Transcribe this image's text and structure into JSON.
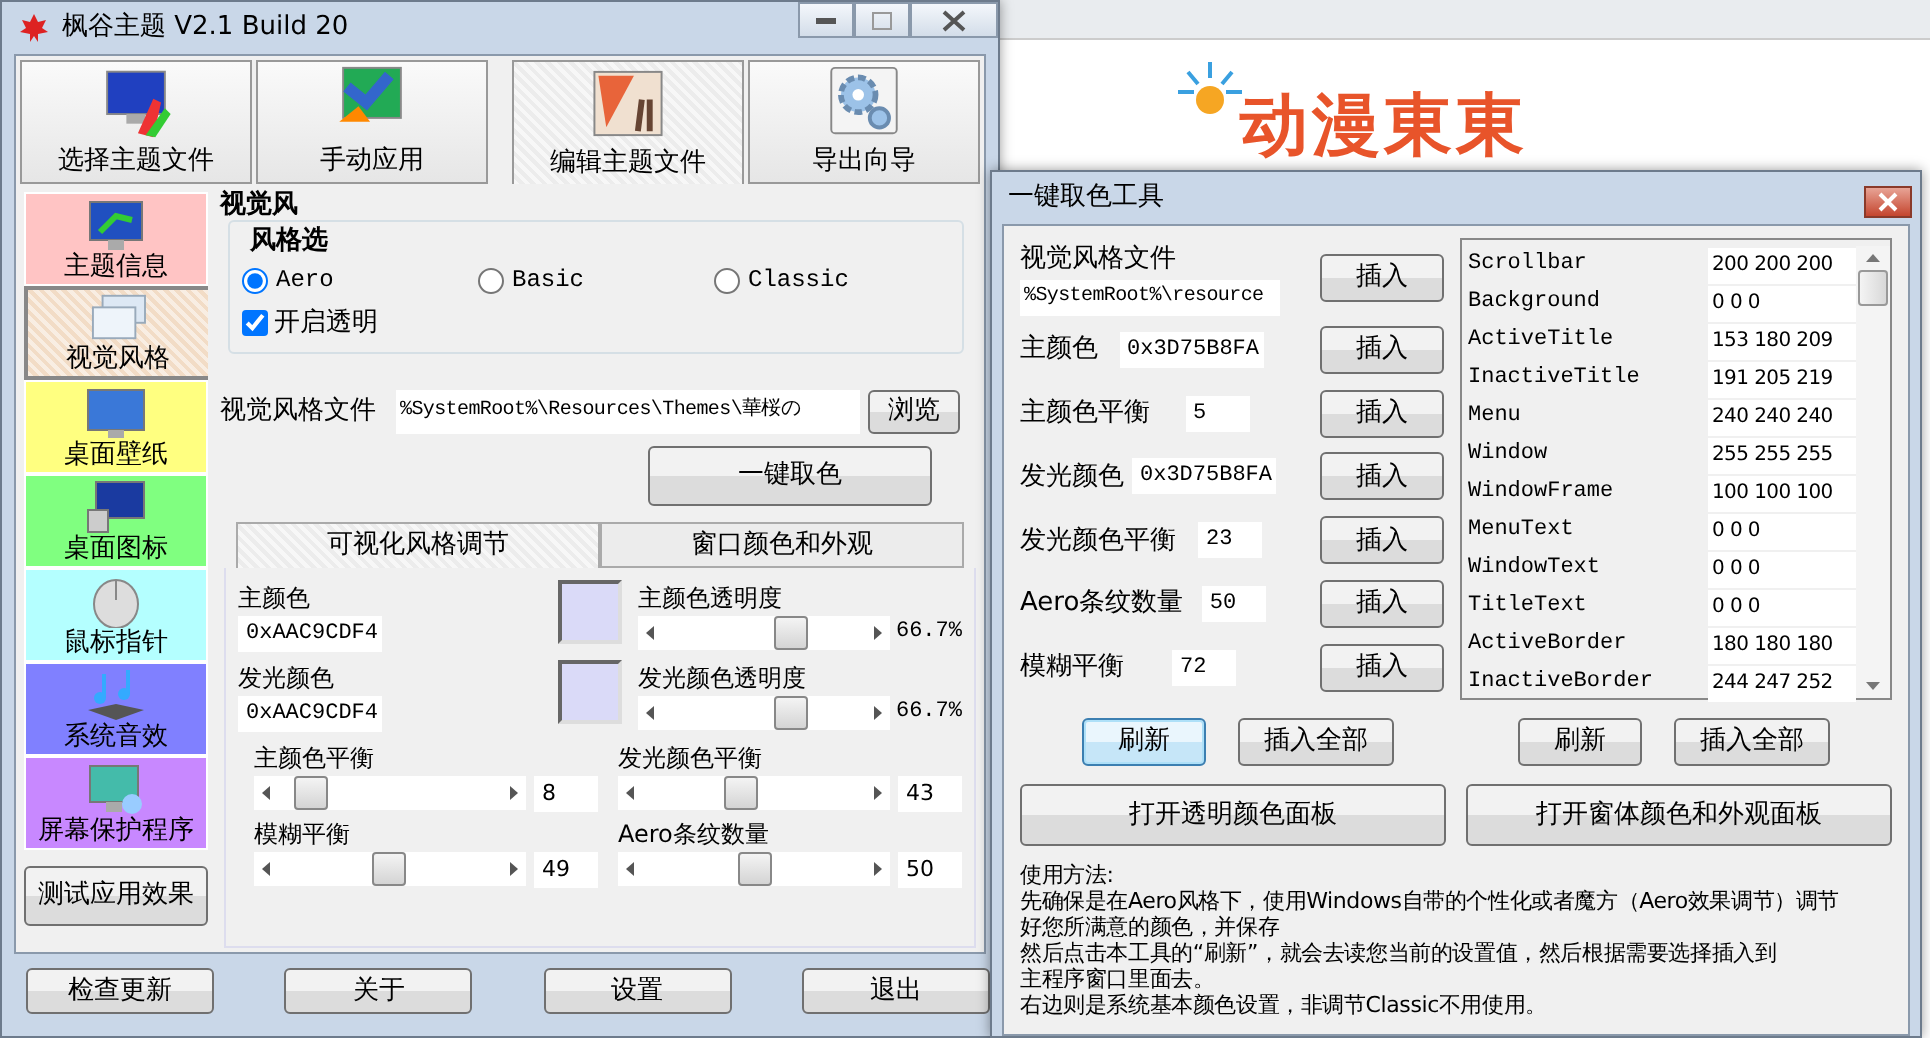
{
  "background": {
    "logo": "动漫東東"
  },
  "main_window": {
    "title": "枫谷主题 V2.1 Build 20",
    "toolbar": [
      {
        "label": "选择主题文件",
        "selected": false
      },
      {
        "label": "手动应用",
        "selected": false
      },
      {
        "label": "编辑主题文件",
        "selected": true
      },
      {
        "label": "导出向导",
        "selected": false
      }
    ],
    "sidebar": [
      {
        "label": "主题信息",
        "color": "#ffc4c4",
        "selected": false
      },
      {
        "label": "视觉风格",
        "color": "#f2dcc6",
        "selected": true
      },
      {
        "label": "桌面壁纸",
        "color": "#ffff80",
        "selected": false
      },
      {
        "label": "桌面图标",
        "color": "#80ff80",
        "selected": false
      },
      {
        "label": "鼠标指针",
        "color": "#b4ffff",
        "selected": false
      },
      {
        "label": "系统音效",
        "color": "#8080ff",
        "selected": false
      },
      {
        "label": "屏幕保护程序",
        "color": "#c888ff",
        "selected": false
      }
    ],
    "sidebar_button": "测试应用效果",
    "section_title": "视觉风",
    "style_group": {
      "title": "风格选",
      "options": [
        {
          "label": "Aero",
          "selected": true
        },
        {
          "label": "Basic",
          "selected": false
        },
        {
          "label": "Classic",
          "selected": false
        }
      ],
      "transparency": {
        "label": "开启透明",
        "checked": true
      }
    },
    "file_label": "视觉风格文件",
    "file_value": "%SystemRoot%\\Resources\\Themes\\華桜の",
    "browse_button": "浏览",
    "pick_button": "一键取色",
    "subtabs": [
      {
        "label": "可视化风格调节",
        "selected": true
      },
      {
        "label": "窗口颜色和外观",
        "selected": false
      }
    ],
    "colors": [
      {
        "label": "主颜色",
        "value": "0xAAC9CDF4",
        "color": "#dadaf8",
        "opacity_label": "主颜色透明度",
        "level": 0.66,
        "reading": "66.7%"
      },
      {
        "label": "发光颜色",
        "value": "0xAAC9CDF4",
        "color": "#dadaf8",
        "opacity_label": "发光颜色透明度",
        "level": 0.66,
        "reading": "66.7%"
      }
    ],
    "sliders": [
      {
        "label": "主颜色平衡",
        "level": 0.08,
        "value": "8"
      },
      {
        "label": "发光颜色平衡",
        "level": 0.43,
        "value": "43"
      },
      {
        "label": "模糊平衡",
        "level": 0.49,
        "value": "49"
      },
      {
        "label": "Aero条纹数量",
        "level": 0.5,
        "value": "50"
      }
    ],
    "footer_buttons": [
      "检查更新",
      "关于",
      "设置",
      "退出"
    ]
  },
  "picker_window": {
    "title": "一键取色工具",
    "fields": [
      {
        "label": "视觉风格文件",
        "value": "%SystemRoot%\\resource",
        "button": "插入",
        "kind": "wide"
      },
      {
        "label": "主颜色",
        "value": "0x3D75B8FA",
        "button": "插入",
        "kind": "medium"
      },
      {
        "label": "主颜色平衡",
        "value": "5",
        "button": "插入",
        "kind": "short"
      },
      {
        "label": "发光颜色",
        "value": "0x3D75B8FA",
        "button": "插入",
        "kind": "medium"
      },
      {
        "label": "发光颜色平衡",
        "value": "23",
        "button": "插入",
        "kind": "short"
      },
      {
        "label": "Aero条纹数量",
        "value": "50",
        "button": "插入",
        "kind": "short"
      },
      {
        "label": "模糊平衡",
        "value": "72",
        "button": "插入",
        "kind": "short"
      }
    ],
    "system_colors": [
      {
        "name": "Scrollbar",
        "value": "200 200 200"
      },
      {
        "name": "Background",
        "value": "0 0 0"
      },
      {
        "name": "ActiveTitle",
        "value": "153 180 209"
      },
      {
        "name": "InactiveTitle",
        "value": "191 205 219"
      },
      {
        "name": "Menu",
        "value": "240 240 240"
      },
      {
        "name": "Window",
        "value": "255 255 255"
      },
      {
        "name": "WindowFrame",
        "value": "100 100 100"
      },
      {
        "name": "MenuText",
        "value": "0 0 0"
      },
      {
        "name": "WindowText",
        "value": "0 0 0"
      },
      {
        "name": "TitleText",
        "value": "0 0 0"
      },
      {
        "name": "ActiveBorder",
        "value": "180 180 180"
      },
      {
        "name": "InactiveBorder",
        "value": "244 247 252"
      }
    ],
    "action_buttons": [
      {
        "label": "刷新",
        "selected": true
      },
      {
        "label": "插入全部",
        "selected": false
      },
      {
        "label": "刷新",
        "selected": false
      },
      {
        "label": "插入全部",
        "selected": false
      }
    ],
    "panel_buttons": [
      "打开透明颜色面板",
      "打开窗体颜色和外观面板"
    ],
    "usage": [
      "使用方法:",
      "先确保是在Aero风格下，使用Windows自带的个性化或者魔方（Aero效果调节）调节",
      "好您所满意的颜色，并保存",
      "然后点击本工具的“刷新”，就会去读您当前的设置值，然后根据需要选择插入到",
      "主程序窗口里面去。",
      "右边则是系统基本颜色设置，非调节Classic不用使用。"
    ]
  }
}
